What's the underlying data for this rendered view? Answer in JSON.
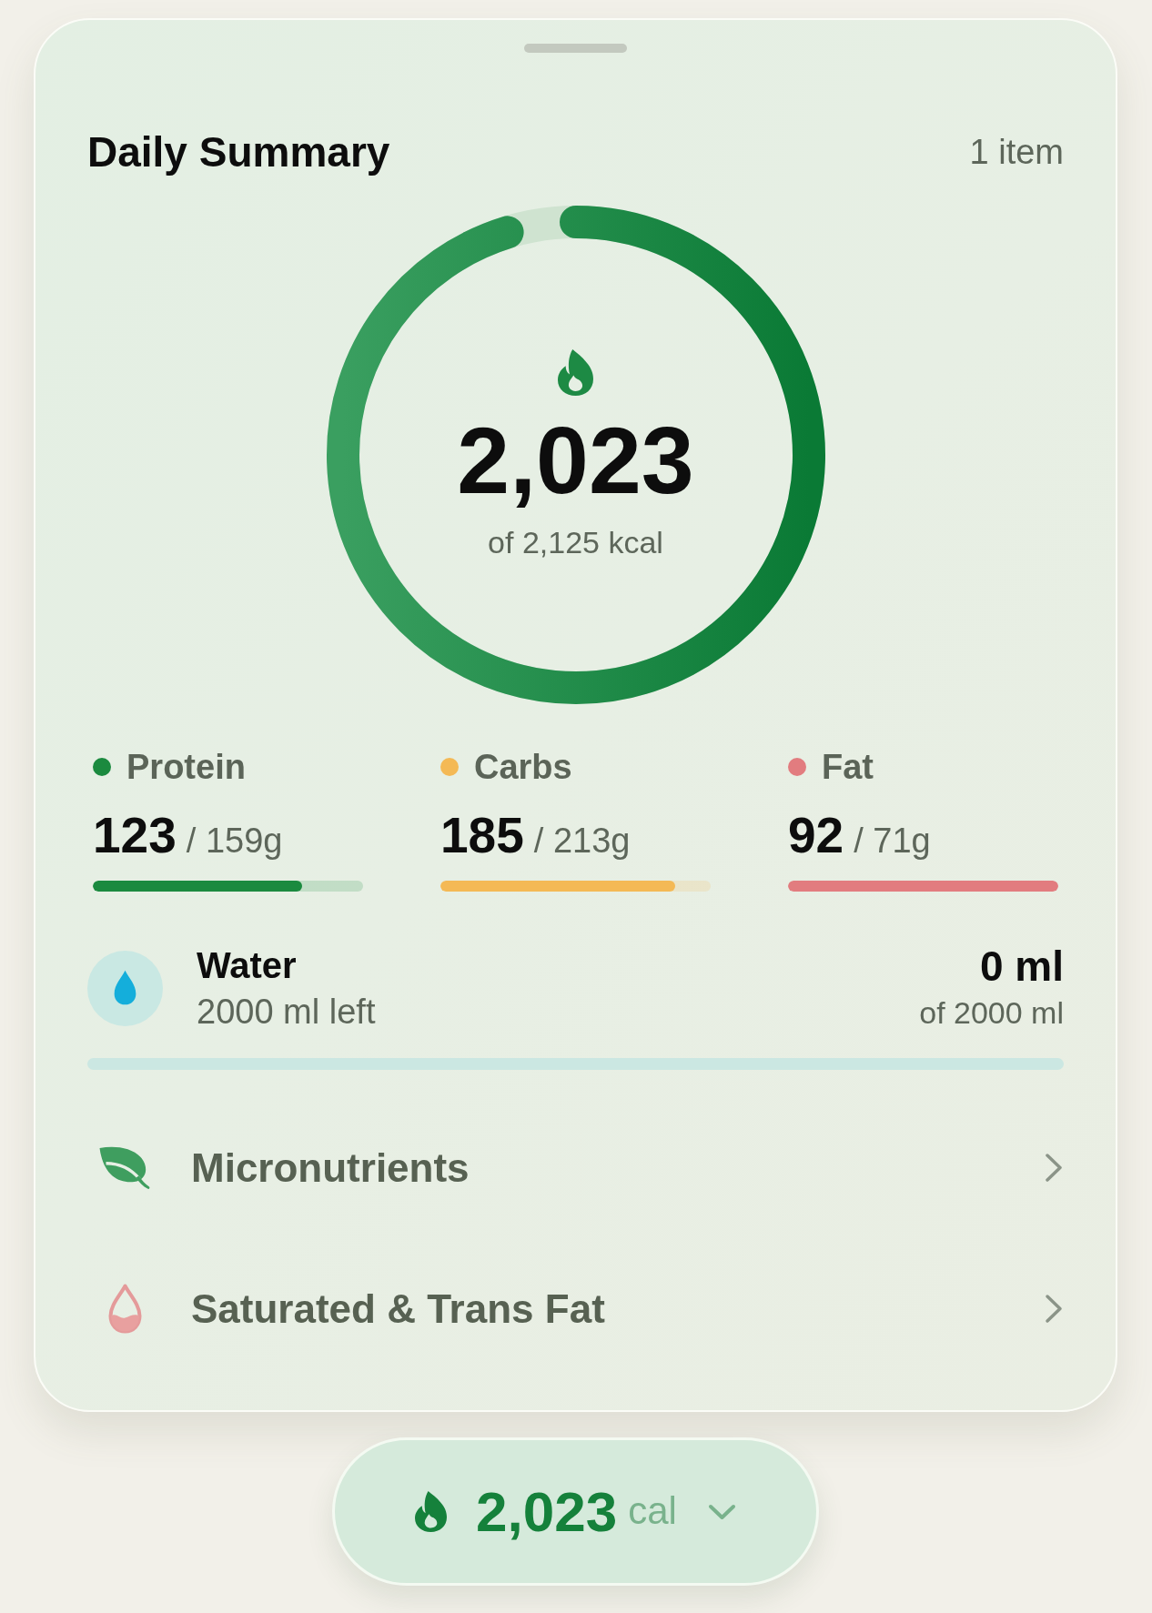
{
  "sheet": {
    "title": "Daily Summary",
    "count": "1 item"
  },
  "calories": {
    "value": "2,023",
    "goal": "of 2,125 kcal",
    "level": 0.952
  },
  "macros": [
    {
      "name": "Protein",
      "color": "#1b8a3f",
      "value": "123",
      "target": "/ 159g",
      "level": 0.774
    },
    {
      "name": "Carbs",
      "color": "#f4b955",
      "value": "185",
      "target": "/ 213g",
      "level": 0.869
    },
    {
      "name": "Fat",
      "color": "#e27c7f",
      "value": "92",
      "target": "/ 71g",
      "level": 1
    }
  ],
  "water": {
    "title": "Water",
    "remaining": "2000 ml left",
    "amount": "0 ml",
    "goal": "of 2000 ml",
    "level": 0
  },
  "links": [
    {
      "kind": "leaf",
      "label": "Micronutrients"
    },
    {
      "kind": "drop",
      "label": "Saturated & Trans Fat"
    }
  ],
  "summary_pill": {
    "value": "2,023",
    "unit": "cal"
  }
}
